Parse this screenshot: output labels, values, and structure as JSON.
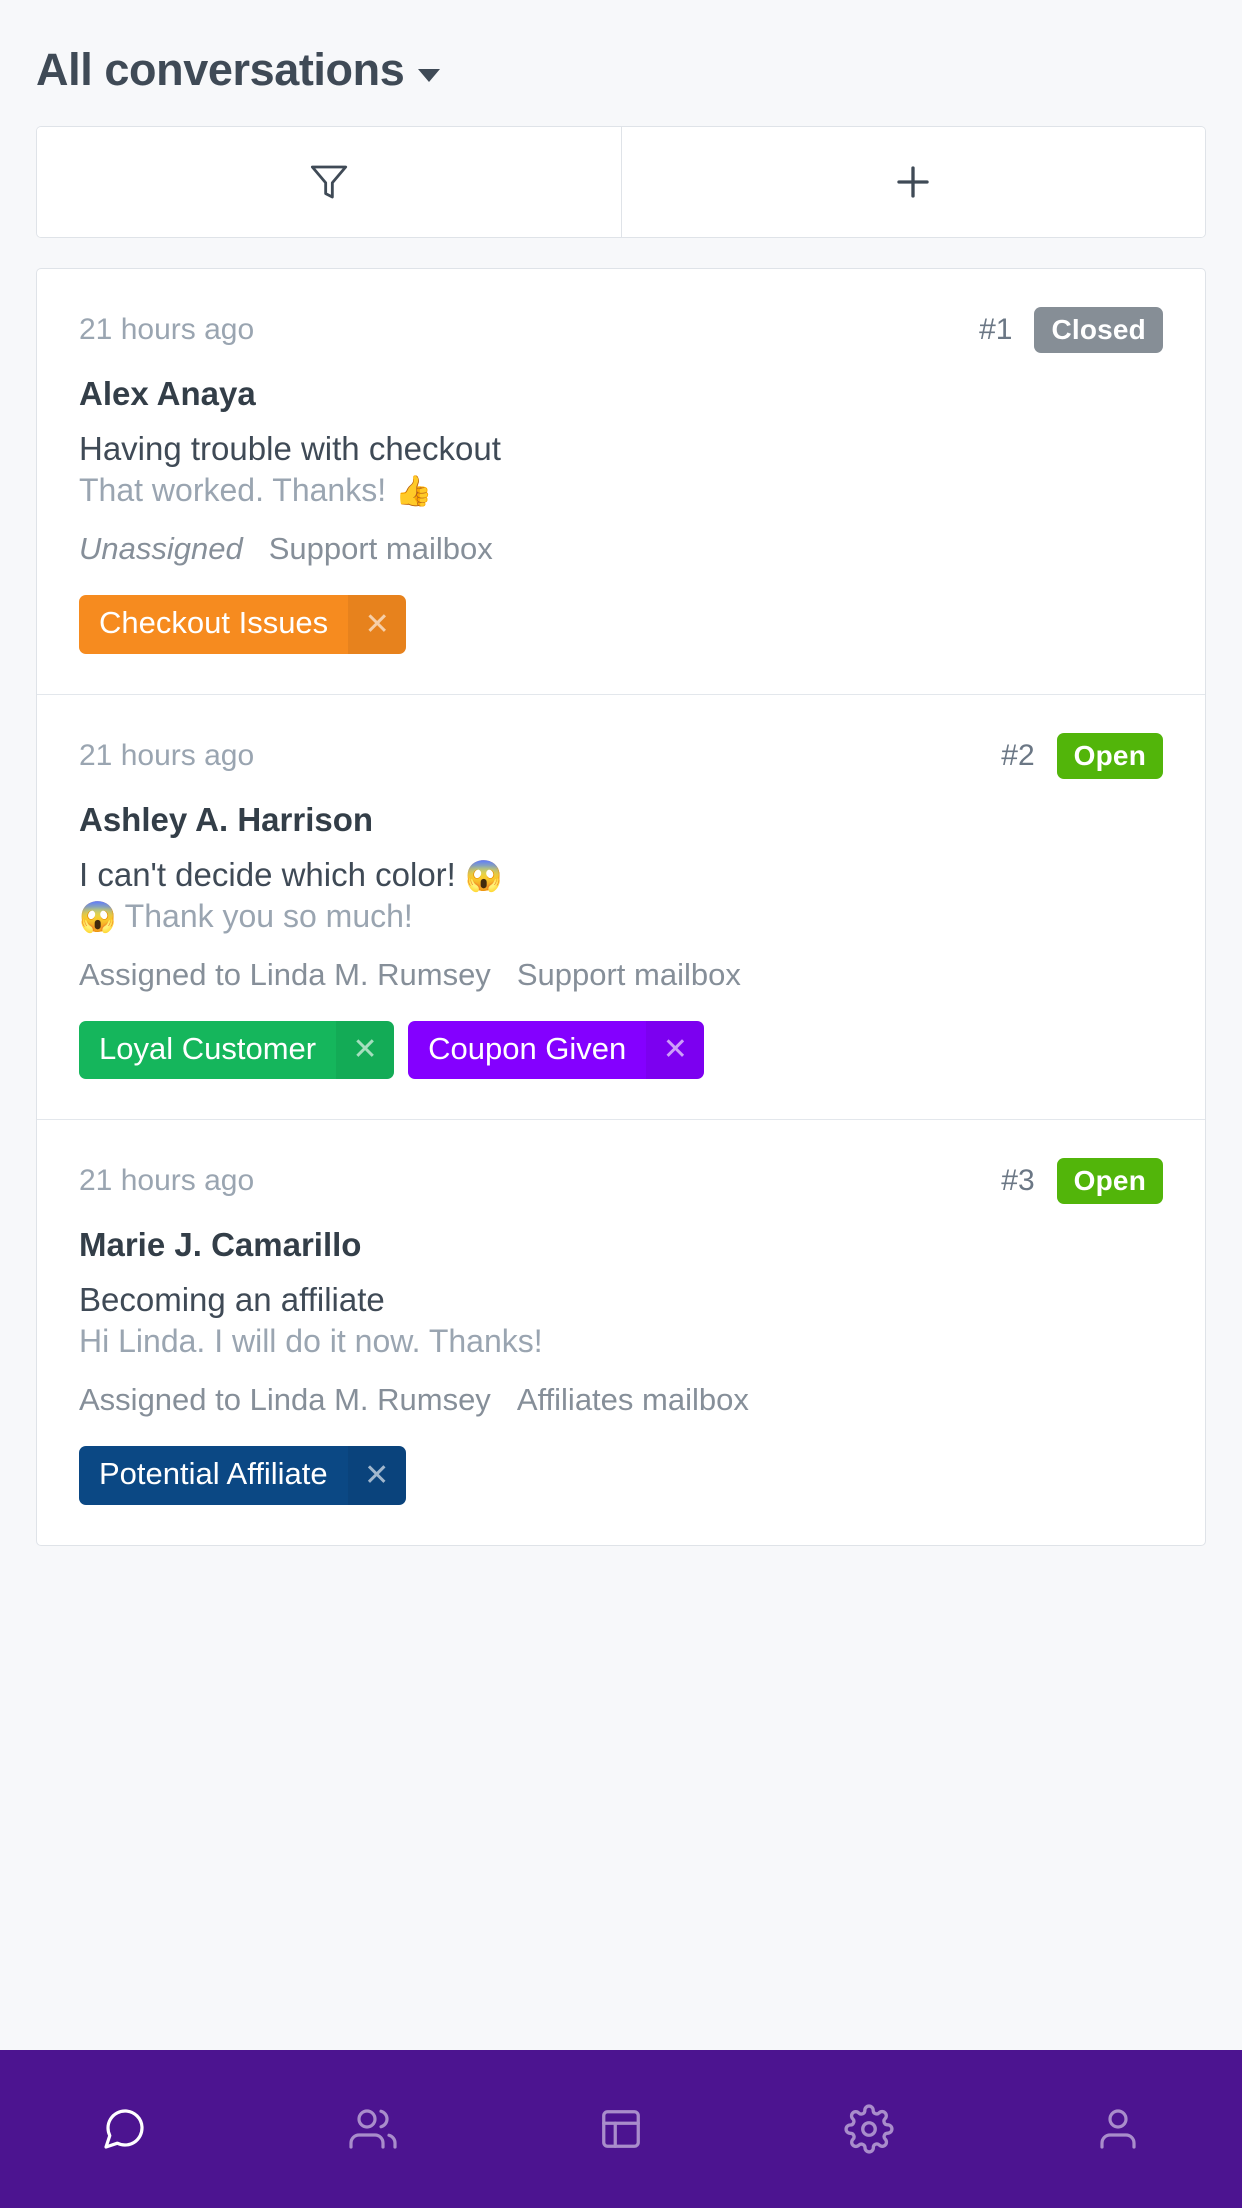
{
  "header": {
    "title": "All conversations",
    "dropdown_icon": "chevron-down-icon"
  },
  "toolbar": {
    "filter_icon": "filter-icon",
    "add_icon": "plus-icon"
  },
  "conversations": [
    {
      "time": "21 hours ago",
      "number": "#1",
      "status": "Closed",
      "status_color": "#868e96",
      "name": "Alex Anaya",
      "subject": "Having trouble with checkout",
      "preview": "That worked. Thanks!",
      "preview_emoji_trailing": "👍",
      "preview_emoji_leading": "",
      "subject_emoji_trailing": "",
      "assignment": "Unassigned",
      "assignment_italic": true,
      "mailbox": "Support mailbox",
      "tags": [
        {
          "label": "Checkout Issues",
          "color": "#f68b1f",
          "remove_icon": "close-icon"
        }
      ]
    },
    {
      "time": "21 hours ago",
      "number": "#2",
      "status": "Open",
      "status_color": "#52b50a",
      "name": "Ashley A. Harrison",
      "subject": "I can't decide which color!",
      "subject_emoji_trailing": "😱",
      "preview": "Thank you so much!",
      "preview_emoji_leading": "😱",
      "preview_emoji_trailing": "",
      "assignment": "Assigned to Linda M. Rumsey",
      "assignment_italic": false,
      "mailbox": "Support mailbox",
      "tags": [
        {
          "label": "Loyal Customer",
          "color": "#15b65c",
          "remove_icon": "close-icon"
        },
        {
          "label": "Coupon Given",
          "color": "#8400ff",
          "remove_icon": "close-icon"
        }
      ]
    },
    {
      "time": "21 hours ago",
      "number": "#3",
      "status": "Open",
      "status_color": "#52b50a",
      "name": "Marie J. Camarillo",
      "subject": "Becoming an affiliate",
      "subject_emoji_trailing": "",
      "preview": "Hi Linda. I will do it now. Thanks!",
      "preview_emoji_leading": "",
      "preview_emoji_trailing": "",
      "assignment": "Assigned to Linda M. Rumsey",
      "assignment_italic": false,
      "mailbox": "Affiliates mailbox",
      "tags": [
        {
          "label": "Potential Affiliate",
          "color": "#0b4884",
          "remove_icon": "close-icon"
        }
      ]
    }
  ],
  "bottom_nav": {
    "background": "#4c1490",
    "items": [
      {
        "icon": "chat-bubble-icon",
        "active": true
      },
      {
        "icon": "users-icon",
        "active": false
      },
      {
        "icon": "layout-dashboard-icon",
        "active": false
      },
      {
        "icon": "gear-icon",
        "active": false
      },
      {
        "icon": "person-icon",
        "active": false
      }
    ]
  }
}
